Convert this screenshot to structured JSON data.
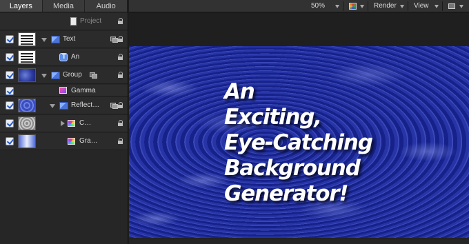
{
  "tabs": [
    {
      "label": "Layers",
      "active": true
    },
    {
      "label": "Media",
      "active": false
    },
    {
      "label": "Audio",
      "active": false
    }
  ],
  "layers": [
    {
      "name": "Project",
      "type": "project",
      "checked": false,
      "dim": true
    },
    {
      "name": "Text",
      "type": "group",
      "checked": true,
      "thumb": "text"
    },
    {
      "name": "An",
      "type": "text",
      "checked": true,
      "thumb": "text"
    },
    {
      "name": "Group",
      "type": "group",
      "checked": true,
      "thumb": "blue"
    },
    {
      "name": "Gamma",
      "type": "filter",
      "checked": true,
      "thumb": ""
    },
    {
      "name": "Reflect…",
      "type": "group",
      "checked": true,
      "thumb": "blue2"
    },
    {
      "name": "C…",
      "type": "generator",
      "checked": true,
      "thumb": "gray"
    },
    {
      "name": "Gra…",
      "type": "generator",
      "checked": true,
      "thumb": "grad"
    }
  ],
  "toolbar": {
    "zoom": "50%",
    "render": "Render",
    "view": "View"
  },
  "canvas": {
    "headline": [
      "An",
      "Exciting,",
      "Eye-Catching",
      "Background",
      "Generator!"
    ]
  },
  "colors": {
    "accent": "#2a5bbd",
    "canvas_blue": "#1c2890"
  }
}
